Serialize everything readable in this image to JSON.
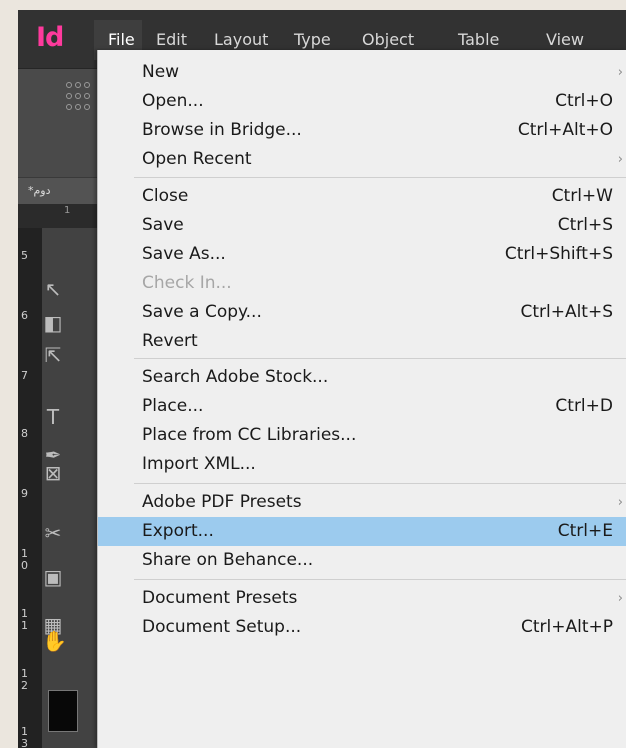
{
  "app": {
    "logo": "Id"
  },
  "menubar": {
    "items": [
      "File",
      "Edit",
      "Layout",
      "Type",
      "Object",
      "Table",
      "View"
    ]
  },
  "workspace": {
    "doc_tab": "*دوم",
    "ruler_top_label": "1",
    "ruler_numbers": [
      "5",
      "6",
      "7",
      "8",
      "9",
      "10",
      "11",
      "12",
      "13"
    ]
  },
  "file_menu": {
    "items": [
      {
        "label": "New",
        "shortcut": "",
        "submenu": true
      },
      {
        "label": "Open...",
        "shortcut": "Ctrl+O"
      },
      {
        "label": "Browse in Bridge...",
        "shortcut": "Ctrl+Alt+O"
      },
      {
        "label": "Open Recent",
        "shortcut": "",
        "submenu": true
      },
      {
        "label": "Close",
        "shortcut": "Ctrl+W"
      },
      {
        "label": "Save",
        "shortcut": "Ctrl+S"
      },
      {
        "label": "Save As...",
        "shortcut": "Ctrl+Shift+S"
      },
      {
        "label": "Check In...",
        "shortcut": "",
        "disabled": true
      },
      {
        "label": "Save a Copy...",
        "shortcut": "Ctrl+Alt+S"
      },
      {
        "label": "Revert",
        "shortcut": ""
      },
      {
        "label": "Search Adobe Stock...",
        "shortcut": ""
      },
      {
        "label": "Place...",
        "shortcut": "Ctrl+D"
      },
      {
        "label": "Place from CC Libraries...",
        "shortcut": ""
      },
      {
        "label": "Import XML...",
        "shortcut": ""
      },
      {
        "label": "Adobe PDF Presets",
        "shortcut": "",
        "submenu": true
      },
      {
        "label": "Export...",
        "shortcut": "Ctrl+E",
        "highlighted": true
      },
      {
        "label": "Share on Behance...",
        "shortcut": ""
      },
      {
        "label": "Document Presets",
        "shortcut": "",
        "submenu": true
      },
      {
        "label": "Document Setup...",
        "shortcut": "Ctrl+Alt+P"
      }
    ]
  },
  "colors": {
    "highlight": "#9ccbee",
    "menu_bg": "#efefef",
    "logo": "#ff3a9d"
  }
}
